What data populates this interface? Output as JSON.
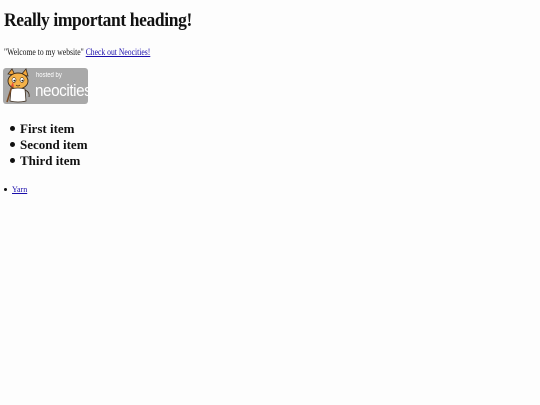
{
  "heading": "Really important heading!",
  "welcome": {
    "text": "\"Welcome to my website\"",
    "link_text": "Check out Neocities!"
  },
  "badge": {
    "hosted_by": "hosted by",
    "brand": "neocities",
    "icon": "neocities-cat-mascot-icon",
    "background_color": "#a9a9a9"
  },
  "big_list": {
    "items": [
      "First item",
      "Second item",
      "Third item"
    ]
  },
  "small_list": {
    "items": [
      "Yarn"
    ]
  },
  "colors": {
    "link": "#1a0dab",
    "text": "#111111",
    "background": "#fdfdfd"
  }
}
